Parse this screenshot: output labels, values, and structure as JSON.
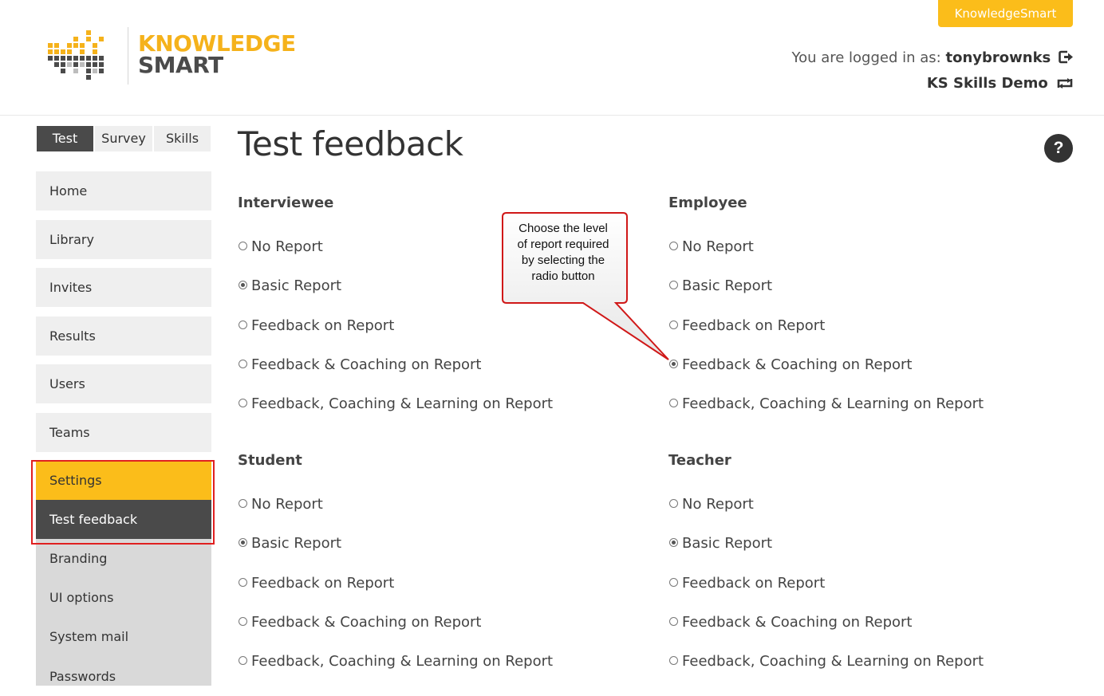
{
  "header": {
    "brand_button": "KnowledgeSmart",
    "logo_line1": "KNOWLEDGE",
    "logo_line2": "SMART",
    "logged_in_prefix": "You are logged in as:",
    "username": "tonybrownks",
    "tenant": "KS Skills Demo",
    "accent_color": "#fbbd1a"
  },
  "sidebar": {
    "tabs": [
      {
        "label": "Test",
        "active": true
      },
      {
        "label": "Survey",
        "active": false
      },
      {
        "label": "Skills",
        "active": false
      }
    ],
    "items": [
      "Home",
      "Library",
      "Invites",
      "Results",
      "Users",
      "Teams"
    ],
    "settings": "Settings",
    "settings_sub": [
      "Test feedback",
      "Branding",
      "UI options",
      "System mail",
      "Passwords"
    ],
    "active_sub": "Test feedback"
  },
  "main": {
    "title": "Test feedback",
    "help": "?",
    "options": [
      "No Report",
      "Basic Report",
      "Feedback on Report",
      "Feedback & Coaching on Report",
      "Feedback, Coaching & Learning on Report"
    ],
    "groups": [
      {
        "title": "Interviewee",
        "selected": "Basic Report"
      },
      {
        "title": "Employee",
        "selected": "Feedback & Coaching on Report"
      },
      {
        "title": "Student",
        "selected": "Basic Report"
      },
      {
        "title": "Teacher",
        "selected": "Basic Report"
      }
    ]
  },
  "callout": {
    "lines": [
      "Choose the level",
      "of report required",
      "by selecting the",
      "radio button"
    ]
  }
}
